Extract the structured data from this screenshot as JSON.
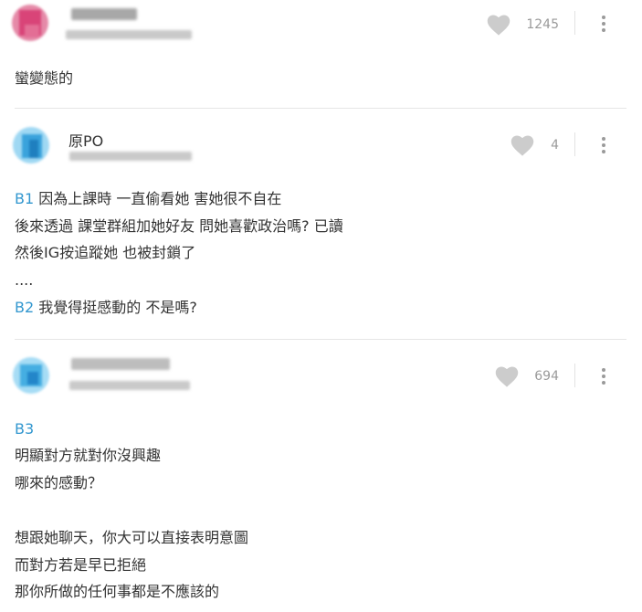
{
  "comments": [
    {
      "name": "",
      "likes": "1245",
      "body": [
        "蠻變態的"
      ]
    },
    {
      "name": "原PO",
      "likes": "4",
      "lines": [
        {
          "floor": "B1",
          "text": "因為上課時 一直偷看她 害她很不自在"
        },
        {
          "floor": "",
          "text": "後來透過 課堂群組加她好友 問她喜歡政治嗎? 已讀"
        },
        {
          "floor": "",
          "text": "然後IG按追蹤她 也被封鎖了"
        },
        {
          "floor": "",
          "text": "...."
        },
        {
          "floor": "B2",
          "text": "我覺得挺感動的  不是嗎?"
        }
      ]
    },
    {
      "name": "",
      "likes": "694",
      "floor": "B3",
      "body": [
        "明顯對方就對你沒興趣",
        "哪來的感動？",
        "",
        "想跟她聊天，你大可以直接表明意圖",
        "而對方若是早已拒絕",
        "那你所做的任何事都是不應該的"
      ]
    }
  ],
  "colors": {
    "floor_link": "#3397cf",
    "heart": "#cccccc",
    "text": "#333333",
    "meta": "#9a9a9a"
  },
  "icons": {
    "like": "heart-icon",
    "more": "more-vertical-icon"
  }
}
